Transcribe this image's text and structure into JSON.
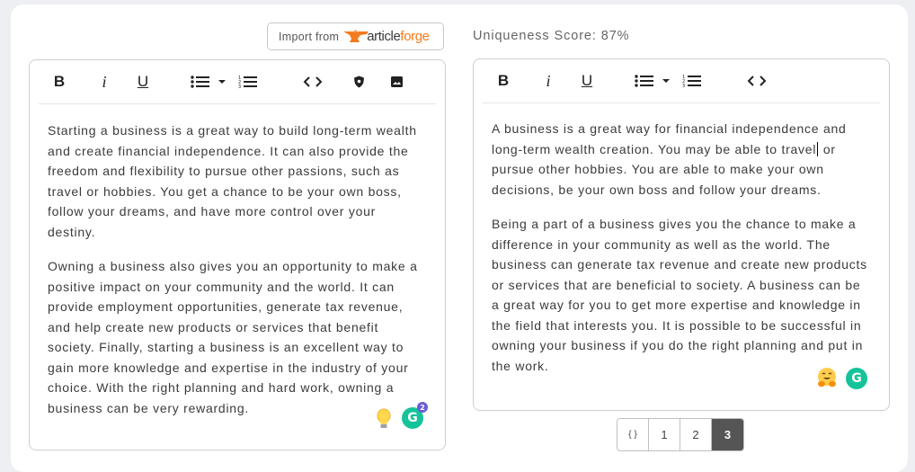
{
  "import": {
    "label": "Import from",
    "brand_article": "article",
    "brand_forge": "forge"
  },
  "uniqueness": {
    "label": "Uniqueness Score: 87%"
  },
  "toolbar": {
    "bold": "B",
    "italic": "i",
    "underline": "U",
    "code": "<>"
  },
  "left_editor": {
    "paragraphs": [
      "Starting a business is a great way to build long-term wealth and create financial independence. It can also provide the freedom and flexibility to pursue other passions, such as travel or hobbies. You get a chance to be your own boss, follow your dreams, and have more control over your destiny.",
      "Owning a business also gives you an opportunity to make a positive impact on your community and the world. It can provide employment opportunities, generate tax revenue, and help create new products or services that benefit society. Finally, starting a business is an excellent way to gain more knowledge and expertise in the industry of your choice. With the right planning and hard work, owning a business can be very rewarding."
    ],
    "grammarly_count": "2"
  },
  "right_editor": {
    "p1_before_caret": "A business is a great way for financial independence and long-term wealth creation. You may be able to travel",
    "p1_after_caret": " or pursue other hobbies. You are able to make your own decisions, be your own boss and follow your dreams.",
    "p2": "Being a part of a business gives you the chance to make a difference in your community as well as the world. The business can generate tax revenue and create new products or services that are beneficial to society. A business can be a great way for you to get more expertise and knowledge in the field that interests you. It is possible to be successful in owning your business if you do the right planning and put in the work."
  },
  "grammarly": {
    "letter": "G"
  },
  "pagination": {
    "json": "{ }",
    "pages": [
      "1",
      "2",
      "3"
    ],
    "active": "3"
  },
  "colors": {
    "brand_orange": "#f47b20",
    "grammarly_green": "#15c39a",
    "badge_purple": "#6b5cd6",
    "active_page": "#555555"
  },
  "icons": [
    "bold-icon",
    "italic-icon",
    "underline-icon",
    "bullet-list-icon",
    "dropdown-caret-icon",
    "numbered-list-icon",
    "code-icon",
    "shield-icon",
    "image-icon",
    "lightbulb-icon",
    "grammarly-icon",
    "hugging-face-emoji-icon",
    "anvil-icon"
  ]
}
